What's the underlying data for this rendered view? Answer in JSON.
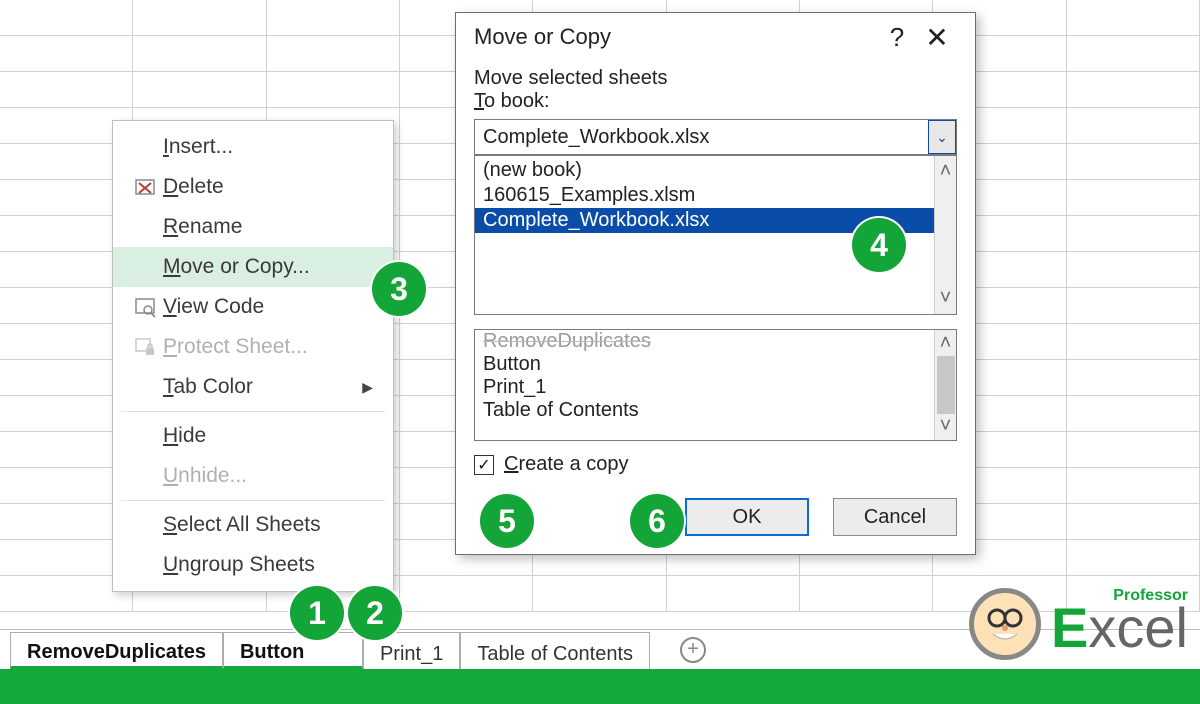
{
  "context_menu": {
    "items": [
      {
        "label": "Insert...",
        "u": "I",
        "icon": "",
        "disabled": false
      },
      {
        "label": "Delete",
        "u": "D",
        "icon": "delete-icon",
        "disabled": false
      },
      {
        "label": "Rename",
        "u": "R",
        "icon": "",
        "disabled": false
      },
      {
        "label": "Move or Copy...",
        "u": "M",
        "icon": "",
        "disabled": false,
        "hover": true
      },
      {
        "label": "View Code",
        "u": "V",
        "icon": "viewcode-icon",
        "disabled": false
      },
      {
        "label": "Protect Sheet...",
        "u": "P",
        "icon": "protect-icon",
        "disabled": true
      },
      {
        "label": "Tab Color",
        "u": "T",
        "icon": "",
        "disabled": false,
        "submenu": true
      },
      {
        "label": "Hide",
        "u": "H",
        "icon": "",
        "disabled": false
      },
      {
        "label": "Unhide...",
        "u": "U",
        "icon": "",
        "disabled": true
      },
      {
        "label": "Select All Sheets",
        "u": "S",
        "icon": "",
        "disabled": false
      },
      {
        "label": "Ungroup Sheets",
        "u": "U",
        "icon": "",
        "disabled": false
      }
    ]
  },
  "dialog": {
    "title": "Move or Copy",
    "help": "?",
    "close": "✕",
    "heading": "Move selected sheets",
    "to_book_label": "To book:",
    "combo_value": "Complete_Workbook.xlsx",
    "book_options": [
      "(new book)",
      "160615_Examples.xlsm",
      "Complete_Workbook.xlsx"
    ],
    "book_selected_index": 2,
    "sheet_options": [
      "RemoveDuplicates",
      "Button",
      "Print_1",
      "Table of Contents"
    ],
    "create_copy_label": "Create a copy",
    "create_copy_checked": true,
    "ok": "OK",
    "cancel": "Cancel"
  },
  "tabs": [
    "RemoveDuplicates",
    "Button",
    "Print_1",
    "Table of Contents"
  ],
  "badges": {
    "b1": "1",
    "b2": "2",
    "b3": "3",
    "b4": "4",
    "b5": "5",
    "b6": "6"
  },
  "logo": {
    "professor": "Professor",
    "word_e": "E",
    "word_rest": "xcel"
  }
}
